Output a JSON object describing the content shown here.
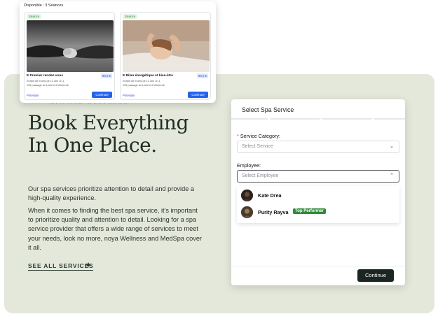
{
  "listing": {
    "title": "Disponible : 3 Séances",
    "cards": [
      {
        "badge": "Séance",
        "name": "E Premier rendez-vous",
        "price": "90,0 €",
        "meta": "Enfant de moins de 12 ans   1h   1",
        "meta2": "195 passage du Lorient 4 Montreuil",
        "preview": "Prévisión",
        "continue": "Continuer"
      },
      {
        "badge": "Séance",
        "name": "E Bilan énergétique et bien-être",
        "price": "90,0 €",
        "meta": "Enfant de moins de 12 ans   1h   1",
        "meta2": "195 passage du Lorient 4 Montreuil",
        "preview": "Prévisión",
        "continue": "Continuer"
      }
    ]
  },
  "hero": {
    "eyebrow": "SPA AND WELLNESS",
    "headline": "Book Everything In One Place.",
    "para1": "Our spa services prioritize attention to detail and provide a high-quality experience.",
    "para2": "When it comes to finding the best spa service, it's important to prioritize quality and attention to detail. Looking for a spa service provider that offers a wide range of services to meet your needs, look no more, noya Wellness and MedSpa cover it all.",
    "see_all": "SEE ALL SERVICES"
  },
  "modal": {
    "title": "Select Spa Service",
    "category_label": "Service Category:",
    "category_required": "*",
    "category_placeholder": "Select Service",
    "employee_label": "Employee:",
    "employee_placeholder": "Select Employee",
    "employees": [
      {
        "name": "Kate Drea",
        "tag": ""
      },
      {
        "name": "Purity Rayva",
        "tag": "Top Performer"
      }
    ],
    "continue": "Continue"
  },
  "colors": {
    "panel_bg": "#e3e8da",
    "dark_green": "#1c2620",
    "blue_accent": "#2563eb",
    "tag_green": "#2f8a3c"
  }
}
